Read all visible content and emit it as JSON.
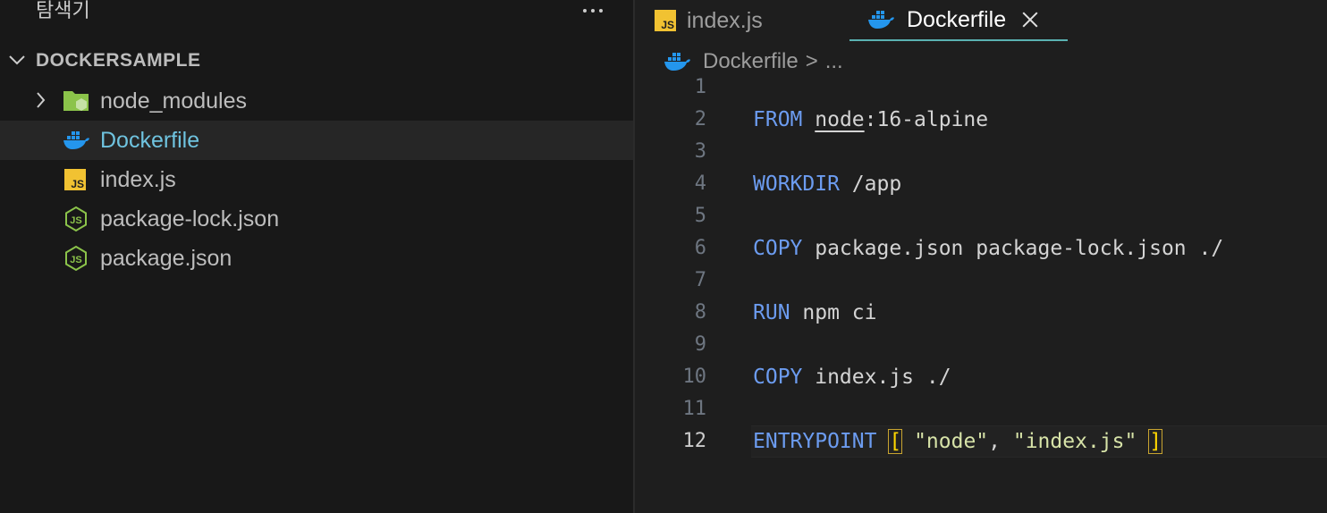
{
  "sidebar": {
    "title": "탐색기",
    "section_title": "DOCKERSAMPLE",
    "items": [
      {
        "label": "node_modules",
        "icon": "folder-node-icon"
      },
      {
        "label": "Dockerfile",
        "icon": "docker-icon"
      },
      {
        "label": "index.js",
        "icon": "js-icon"
      },
      {
        "label": "package-lock.json",
        "icon": "nodejs-icon"
      },
      {
        "label": "package.json",
        "icon": "nodejs-icon"
      }
    ]
  },
  "tabs": [
    {
      "label": "index.js",
      "icon": "js-icon",
      "active": false
    },
    {
      "label": "Dockerfile",
      "icon": "docker-icon",
      "active": true
    }
  ],
  "js_badge": "JS",
  "breadcrumb": {
    "file": "Dockerfile",
    "sep": ">",
    "rest": "..."
  },
  "editor": {
    "line_numbers": [
      "1",
      "2",
      "3",
      "4",
      "5",
      "6",
      "7",
      "8",
      "9",
      "10",
      "11",
      "12"
    ],
    "code": {
      "l2_kw": "FROM",
      "l2_img": "node",
      "l2_rest": ":16-alpine",
      "l4_kw": "WORKDIR",
      "l4_rest": " /app",
      "l6_kw": "COPY",
      "l6_rest": " package.json package-lock.json ./",
      "l8_kw": "RUN",
      "l8_rest": " npm ci",
      "l10_kw": "COPY",
      "l10_rest": " index.js ./",
      "l12_kw": "ENTRYPOINT",
      "l12_open": "[",
      "l12_s1": "\"node\"",
      "l12_comma": ", ",
      "l12_s2": "\"index.js\"",
      "l12_close": "]"
    }
  },
  "colors": {
    "keyword": "#6c9cf0",
    "string": "#d7e3a8",
    "selected_text": "#6fc3df",
    "tab_underline": "#5ab2b2"
  }
}
